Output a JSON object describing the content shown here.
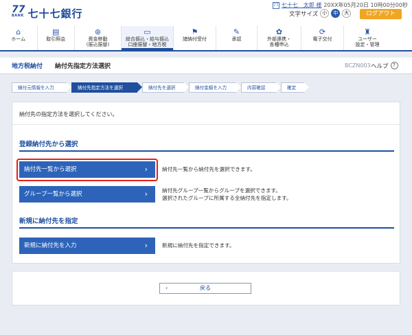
{
  "bank": {
    "mark": "77",
    "mark_sub": "BANK",
    "name": "七十七銀行"
  },
  "user": {
    "icon": "user-card-icon",
    "name": "七十七　太郎 様",
    "login_time": "20XX年05月20日 10時00分00秒"
  },
  "font_size": {
    "label": "文字サイズ",
    "options": [
      "小",
      "中",
      "大"
    ],
    "selected": "中"
  },
  "logout_label": "ログアウト",
  "global_nav": [
    {
      "label": "ホーム",
      "icon": "home-icon"
    },
    {
      "label": "取引照会",
      "icon": "document-icon"
    },
    {
      "label": "資金移動\n(振込振替)",
      "icon": "transfer-icon"
    },
    {
      "label": "総合振込・給与振込\n口座振替・地方税",
      "icon": "card-icon",
      "current": true
    },
    {
      "label": "諸納付受付",
      "icon": "payment-icon"
    },
    {
      "label": "承認",
      "icon": "approve-icon"
    },
    {
      "label": "外部連携・\n各種申込",
      "icon": "link-icon"
    },
    {
      "label": "電子交付",
      "icon": "refresh-icon"
    },
    {
      "label": "ユーザー\n設定・管理",
      "icon": "user-settings-icon"
    }
  ],
  "title": {
    "main": "地方税納付",
    "sub": "納付先指定方法選択",
    "screen_id": "BCZN003",
    "help": "ヘルプ"
  },
  "steps": [
    "納付元情報を入力",
    "納付先指定方法を選択",
    "納付先を選択",
    "納付金額を入力",
    "内容確認",
    "確定"
  ],
  "active_step": 1,
  "intro": "納付先の指定方法を選択してください。",
  "sections": {
    "registered": {
      "heading": "登録納付先から選択",
      "actions": [
        {
          "label": "納付先一覧から選択",
          "desc": "納付先一覧から納付先を選択できます。"
        },
        {
          "label": "グループ一覧から選択",
          "desc": "納付先グループ一覧からグループを選択できます。\n選択されたグループに所属する全納付先を指定します。"
        }
      ]
    },
    "new": {
      "heading": "新規に納付先を指定",
      "actions": [
        {
          "label": "新規に納付先を入力",
          "desc": "新規に納付先を指定できます。"
        }
      ]
    }
  },
  "back_label": "戻る",
  "colors": {
    "brand": "#1f4f9e",
    "button": "#2d64b9",
    "logout": "#f0a623",
    "highlight": "#e41e1e"
  }
}
